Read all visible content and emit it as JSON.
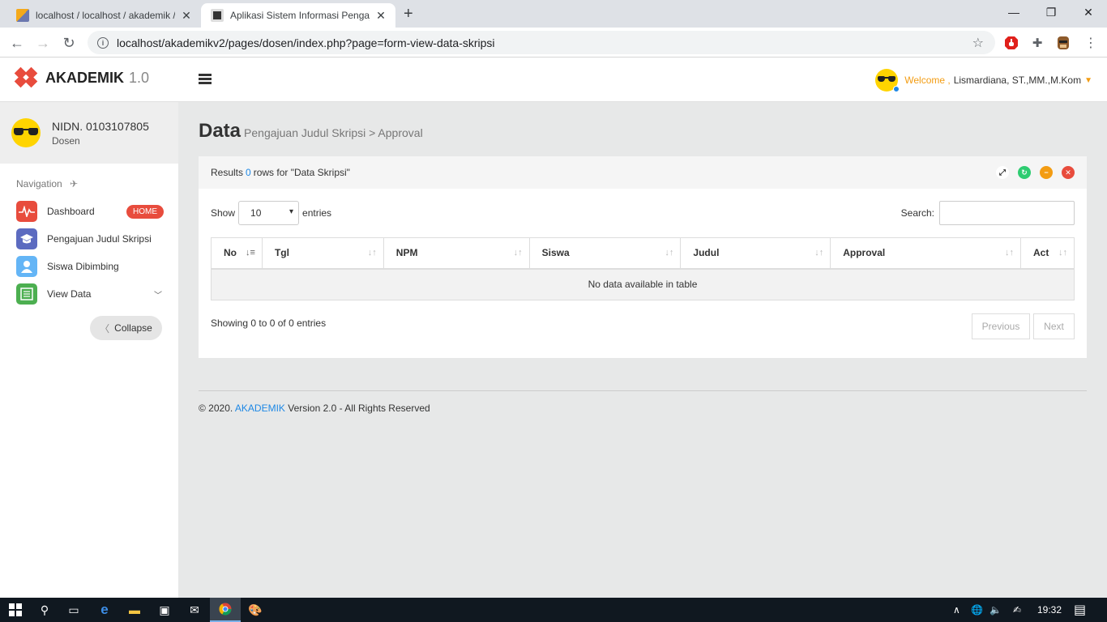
{
  "browser": {
    "tabs": [
      {
        "title": "localhost / localhost / akademik /",
        "close": "✕"
      },
      {
        "title": "Aplikasi Sistem Informasi Pengaju",
        "close": "✕"
      }
    ],
    "new_tab": "+",
    "url": "localhost/akademikv2/pages/dosen/index.php?page=form-view-data-skripsi",
    "window": {
      "minimize": "—",
      "restore": "❐",
      "close": "✕"
    }
  },
  "header": {
    "logo": "AKADEMIK",
    "version": "1.0",
    "welcome": "Welcome ,",
    "user": "Lismardiana, ST.,MM.,M.Kom",
    "caret": "▼"
  },
  "sidebar": {
    "nidn": "NIDN. 0103107805",
    "role": "Dosen",
    "nav_title": "Navigation",
    "items": [
      {
        "label": "Dashboard",
        "badge": "HOME",
        "color": "#e84c3d"
      },
      {
        "label": "Pengajuan Judul Skripsi",
        "color": "#5c6bc0"
      },
      {
        "label": "Siswa Dibimbing",
        "color": "#64b5f6"
      },
      {
        "label": "View Data",
        "color": "#4caf50"
      }
    ],
    "collapse": "Collapse"
  },
  "page": {
    "title": "Data",
    "subtitle": "Pengajuan Judul Skripsi > Approval"
  },
  "panel": {
    "results_prefix": "Results",
    "results_count": "0",
    "results_suffix": "rows for \"Data Skripsi\"",
    "show": "Show",
    "entries_value": "10",
    "entries": "entries",
    "search_label": "Search:",
    "columns": [
      "No",
      "Tgl",
      "NPM",
      "Siswa",
      "Judul",
      "Approval",
      "Act"
    ],
    "empty": "No data available in table",
    "showing": "Showing 0 to 0 of 0 entries",
    "previous": "Previous",
    "next": "Next"
  },
  "footer": {
    "prefix": "© 2020.",
    "brand": "AKADEMIK",
    "suffix": "Version 2.0 - All Rights Reserved"
  },
  "taskbar": {
    "time": "19:32"
  },
  "colors": {
    "accent_red": "#e84c3d",
    "link_blue": "#1e88e5",
    "welcome_orange": "#f39c12"
  }
}
